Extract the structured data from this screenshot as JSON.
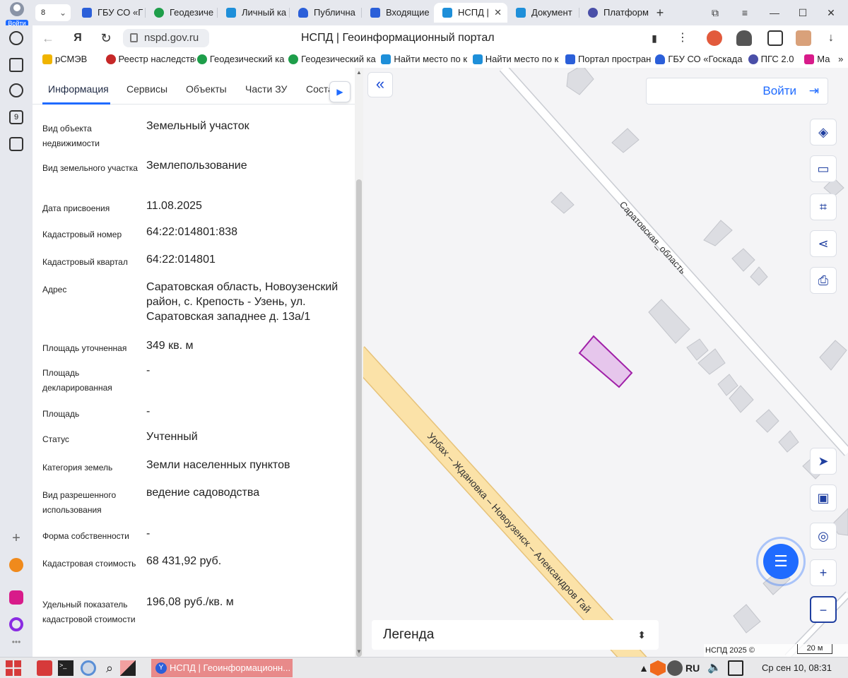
{
  "browser": {
    "profile_label": "Войти",
    "tab_count": "8",
    "tabs": [
      {
        "label": "ГБУ СО «Г",
        "color": "#2b5fd9"
      },
      {
        "label": "Геодезиче",
        "color": "#1e9e4a"
      },
      {
        "label": "Личный ка",
        "color": "#1e8fd9"
      },
      {
        "label": "Публична",
        "color": "#2b5fd9"
      },
      {
        "label": "Входящие",
        "color": "#2b5fd9"
      },
      {
        "label": "НСПД |",
        "color": "#1e8fd9",
        "active": true
      },
      {
        "label": "Документ",
        "color": "#1e8fd9"
      },
      {
        "label": "Платформ",
        "color": "#4a4fa8"
      }
    ],
    "url": "nspd.gov.ru",
    "page_title": "НСПД | Геоинформационный портал",
    "bookmarks": [
      {
        "label": "рСМЭВ",
        "color": "#f0b400"
      },
      {
        "label": "Реестр наследстве",
        "color": "#c62828"
      },
      {
        "label": "Геодезический ка",
        "color": "#1e9e4a"
      },
      {
        "label": "Геодезический ка",
        "color": "#1e9e4a"
      },
      {
        "label": "Найти место по к",
        "color": "#1e8fd9"
      },
      {
        "label": "Найти место по к",
        "color": "#1e8fd9"
      },
      {
        "label": "Портал простран",
        "color": "#2b5fd9"
      },
      {
        "label": "ГБУ СО «Госкада",
        "color": "#2b5fd9"
      },
      {
        "label": "ПГС 2.0",
        "color": "#4a4fa8"
      },
      {
        "label": "Ма",
        "color": "#d81b8a"
      }
    ],
    "bookmarks_more": "»"
  },
  "panel": {
    "tabs": [
      "Информация",
      "Сервисы",
      "Объекты",
      "Части ЗУ",
      "Соста"
    ],
    "rows": [
      {
        "label": "Вид объекта недвижимости",
        "value": "Земельный участок"
      },
      {
        "label": "Вид земельного участка",
        "value": "Землепользование"
      },
      {
        "label": "Дата присвоения",
        "value": "11.08.2025"
      },
      {
        "label": "Кадастровый номер",
        "value": "64:22:014801:838"
      },
      {
        "label": "Кадастровый квартал",
        "value": "64:22:014801"
      },
      {
        "label": "Адрес",
        "value": "Саратовская область, Новоузенский район, с. Крепость - Узень, ул. Саратовская западнее д. 13а/1"
      },
      {
        "label": "Площадь уточненная",
        "value": "349 кв. м"
      },
      {
        "label": "Площадь декларированная",
        "value": "-"
      },
      {
        "label": "Площадь",
        "value": "-"
      },
      {
        "label": "Статус",
        "value": "Учтенный"
      },
      {
        "label": "Категория земель",
        "value": "Земли населенных пунктов"
      },
      {
        "label": "Вид разрешенного использования",
        "value": "ведение садоводства"
      },
      {
        "label": "Форма собственности",
        "value": "-"
      },
      {
        "label": "Кадастровая стоимость",
        "value": "68 431,92 руб."
      },
      {
        "label": "Удельный показатель кадастровой стоимости",
        "value": "196,08 руб./кв. м"
      }
    ]
  },
  "map": {
    "login_label": "Войти",
    "road_label_1": "Саратовская_область",
    "road_label_2": "Урбах – Ждановка – Новоузенск – Александров Гай",
    "legend_label": "Легенда",
    "attribution": "НСПД 2025 ©",
    "scale_label": "20 м",
    "parcel_color": "#e6c6ec",
    "parcel_stroke": "#a020a8",
    "road_color": "#fbe2a8"
  },
  "taskbar": {
    "task_label": "НСПД | Геоинформационн...",
    "task_icon": "Y",
    "language": "RU",
    "clock": "Ср сен 10, 08:31"
  }
}
